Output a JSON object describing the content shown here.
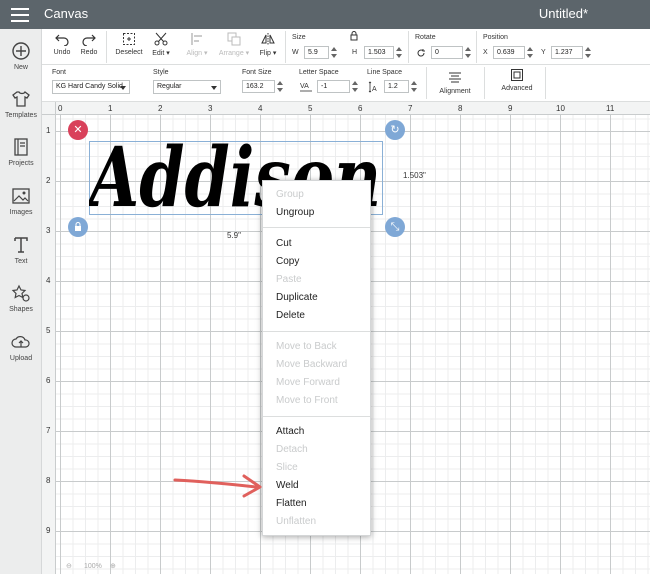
{
  "header": {
    "app_title": "Canvas",
    "doc_title": "Untitled*"
  },
  "sidebar": {
    "items": [
      {
        "label": "New",
        "icon": "plus-circle-icon"
      },
      {
        "label": "Templates",
        "icon": "tshirt-icon"
      },
      {
        "label": "Projects",
        "icon": "book-icon"
      },
      {
        "label": "Images",
        "icon": "image-icon"
      },
      {
        "label": "Text",
        "icon": "text-icon"
      },
      {
        "label": "Shapes",
        "icon": "shapes-icon"
      },
      {
        "label": "Upload",
        "icon": "cloud-upload-icon"
      }
    ]
  },
  "toolbar": {
    "undo": "Undo",
    "redo": "Redo",
    "deselect": "Deselect",
    "edit": "Edit",
    "align": "Align",
    "arrange": "Arrange",
    "flip": "Flip",
    "size_label": "Size",
    "w_label": "W",
    "w_value": "5.9",
    "h_label": "H",
    "h_value": "1.503",
    "rotate_label": "Rotate",
    "rotate_value": "0",
    "position_label": "Position",
    "x_label": "X",
    "x_value": "0.639",
    "y_label": "Y",
    "y_value": "1.237"
  },
  "textbar": {
    "font_label": "Font",
    "font_value": "KG Hard Candy Solid",
    "style_label": "Style",
    "style_value": "Regular",
    "font_size_label": "Font Size",
    "font_size_value": "163.2",
    "letter_space_label": "Letter Space",
    "letter_space_value": "-1",
    "line_space_label": "Line Space",
    "line_space_value": "1.2",
    "alignment": "Alignment",
    "advanced": "Advanced"
  },
  "ruler": {
    "top": [
      "0",
      "1",
      "2",
      "3",
      "4",
      "5",
      "6",
      "7",
      "8",
      "9",
      "10",
      "11"
    ],
    "left": [
      "1",
      "2",
      "3",
      "4",
      "5",
      "6",
      "7",
      "8",
      "9"
    ]
  },
  "canvas": {
    "text": "Addison",
    "width_label": "5.9\"",
    "height_label": "1.503\""
  },
  "context_menu": {
    "group": "Group",
    "ungroup": "Ungroup",
    "cut": "Cut",
    "copy": "Copy",
    "paste": "Paste",
    "duplicate": "Duplicate",
    "delete": "Delete",
    "move_to_back": "Move to Back",
    "move_backward": "Move Backward",
    "move_forward": "Move Forward",
    "move_to_front": "Move to Front",
    "attach": "Attach",
    "detach": "Detach",
    "slice": "Slice",
    "weld": "Weld",
    "flatten": "Flatten",
    "unflatten": "Unflatten"
  },
  "zoom": {
    "value": "100%"
  },
  "colors": {
    "header": "#5c656b",
    "delete_handle": "#d9415b",
    "handle_blue": "#7fa8d6",
    "arrow": "#e0605c"
  }
}
